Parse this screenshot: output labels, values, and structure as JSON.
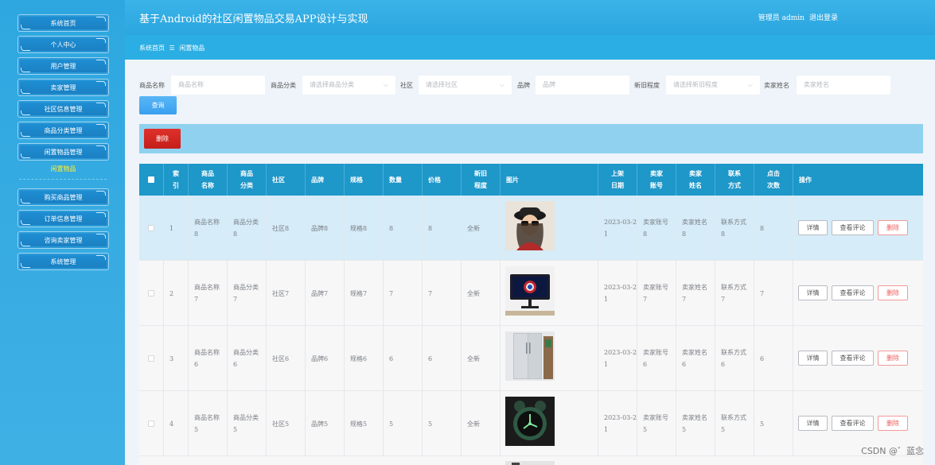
{
  "app": {
    "title": "基于Android的社区闲置物品交易APP设计与实现",
    "user_label": "管理员 admin",
    "logout": "退出登录"
  },
  "sidebar": {
    "items": [
      {
        "label": "系统首页"
      },
      {
        "label": "个人中心"
      },
      {
        "label": "用户管理"
      },
      {
        "label": "卖家管理"
      },
      {
        "label": "社区信息管理"
      },
      {
        "label": "商品分类管理"
      },
      {
        "label": "闲置物品管理"
      },
      {
        "label": "购买商品管理"
      },
      {
        "label": "订单信息管理"
      },
      {
        "label": "咨询卖家管理"
      },
      {
        "label": "系统管理"
      }
    ],
    "active_sub": "闲置物品"
  },
  "breadcrumb": {
    "home": "系统首页",
    "sep": "☰",
    "current": "闲置物品"
  },
  "search": {
    "name_label": "商品名称",
    "name_placeholder": "商品名称",
    "category_label": "商品分类",
    "category_placeholder": "请选择商品分类",
    "community_label": "社区",
    "community_placeholder": "请选择社区",
    "brand_label": "品牌",
    "brand_placeholder": "品牌",
    "condition_label": "新旧程度",
    "condition_placeholder": "请选择新旧程度",
    "seller_label": "卖家姓名",
    "seller_placeholder": "卖家姓名",
    "query_button": "查询"
  },
  "toolbar": {
    "delete_button": "删除"
  },
  "table": {
    "headers": {
      "index": "索\n引",
      "name": "商品\n名称",
      "category": "商品\n分类",
      "community": "社区",
      "brand": "品牌",
      "spec": "规格",
      "quantity": "数量",
      "price": "价格",
      "condition": "新旧\n程度",
      "image": "图片",
      "date": "上架\n日期",
      "seller_account": "卖家\n账号",
      "seller_name": "卖家\n姓名",
      "contact": "联系\n方式",
      "clicks": "点击\n次数",
      "ops": "操作"
    },
    "rows": [
      {
        "index": "1",
        "name": "商品名称\n8",
        "category": "商品分类\n8",
        "community": "社区8",
        "brand": "品牌8",
        "spec": "规格8",
        "quantity": "8",
        "price": "8",
        "condition": "全新",
        "image": "woman-in-hat-photo",
        "date": "2023-03-2\n1",
        "seller_account": "卖家账号\n8",
        "seller_name": "卖家姓名\n8",
        "contact": "联系方式\n8",
        "clicks": "8"
      },
      {
        "index": "2",
        "name": "商品名称\n7",
        "category": "商品分类\n7",
        "community": "社区7",
        "brand": "品牌7",
        "spec": "规格7",
        "quantity": "7",
        "price": "7",
        "condition": "全新",
        "image": "monitor-photo",
        "date": "2023-03-2\n1",
        "seller_account": "卖家账号\n7",
        "seller_name": "卖家姓名\n7",
        "contact": "联系方式\n7",
        "clicks": "7"
      },
      {
        "index": "3",
        "name": "商品名称\n6",
        "category": "商品分类\n6",
        "community": "社区6",
        "brand": "品牌6",
        "spec": "规格6",
        "quantity": "6",
        "price": "6",
        "condition": "全新",
        "image": "refrigerator-photo",
        "date": "2023-03-2\n1",
        "seller_account": "卖家账号\n6",
        "seller_name": "卖家姓名\n6",
        "contact": "联系方式\n6",
        "clicks": "6"
      },
      {
        "index": "4",
        "name": "商品名称\n5",
        "category": "商品分类\n5",
        "community": "社区5",
        "brand": "品牌5",
        "spec": "规格5",
        "quantity": "5",
        "price": "5",
        "condition": "全新",
        "image": "alarm-clock-photo",
        "date": "2023-03-2\n1",
        "seller_account": "卖家账号\n5",
        "seller_name": "卖家姓名\n5",
        "contact": "联系方式\n5",
        "clicks": "5"
      }
    ],
    "op_detail": "详情",
    "op_comments": "查看评论",
    "op_delete": "删除"
  },
  "watermark": "CSDN @゛蓝念"
}
